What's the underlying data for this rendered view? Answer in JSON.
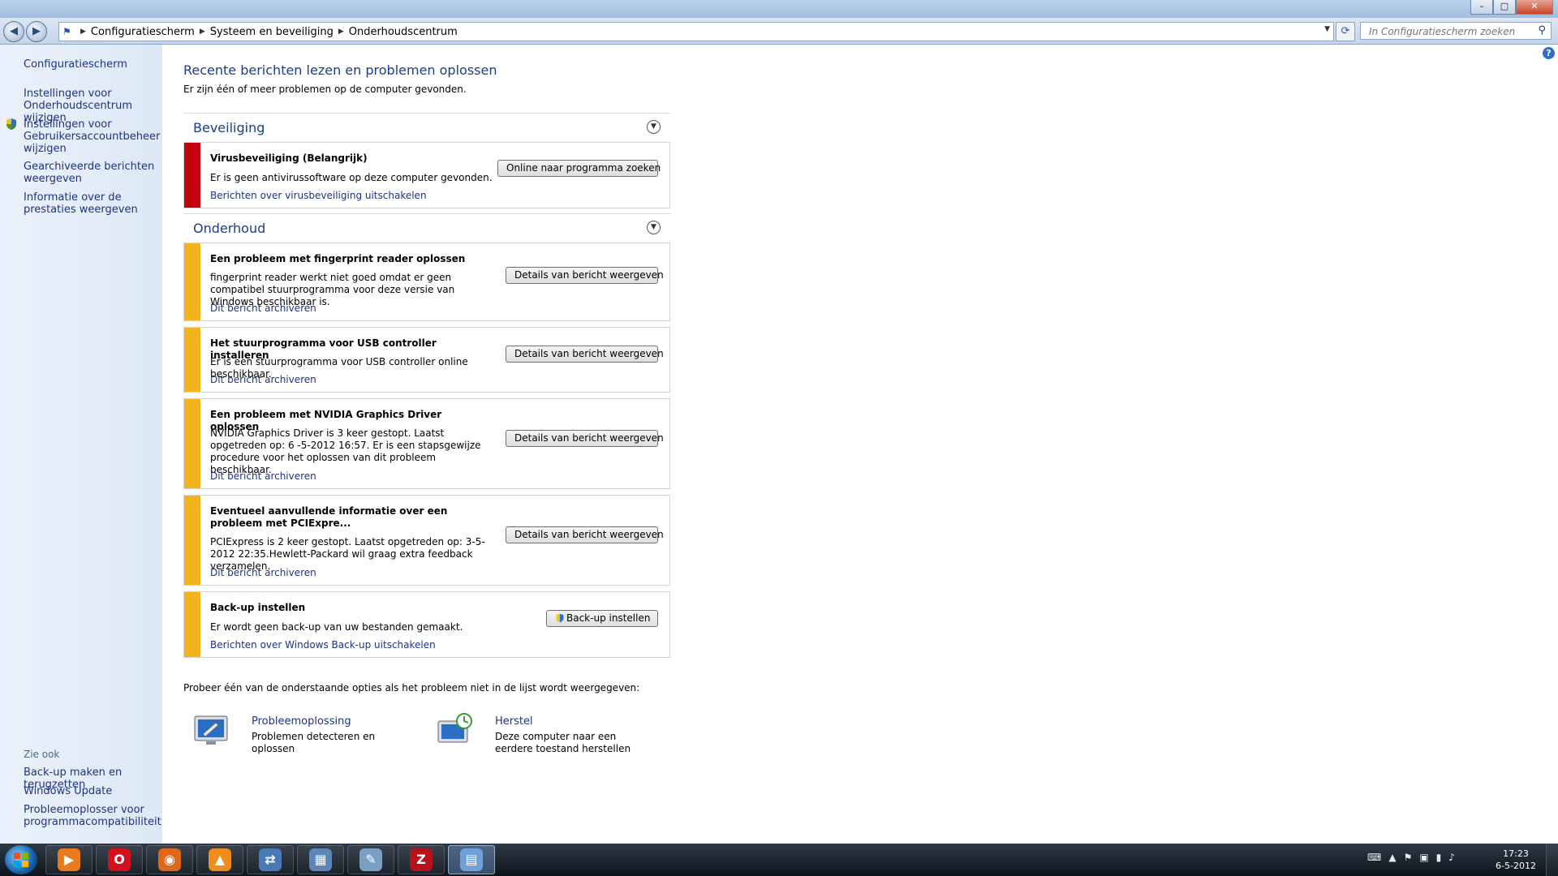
{
  "window": {
    "caption": {
      "minimize": "–",
      "maximize": "□",
      "close": "✕"
    }
  },
  "nav": {
    "back_icon": "◀",
    "forward_icon": "▶",
    "breadcrumbs": [
      "Configuratiescherm",
      "Systeem en beveiliging",
      "Onderhoudscentrum"
    ],
    "refresh_icon": "⟳",
    "search_placeholder": "In Configuratiescherm zoeken",
    "search_icon": "⚲"
  },
  "sidebar": {
    "home": "Configuratiescherm",
    "links": [
      "Instellingen voor Onderhoudscentrum wijzigen",
      "Instellingen voor Gebruikersaccountbeheer wijzigen",
      "Gearchiveerde berichten weergeven",
      "Informatie over de prestaties weergeven"
    ],
    "see_also_title": "Zie ook",
    "see_also": [
      "Back-up maken en terugzetten",
      "Windows Update",
      "Probleemoplosser voor programmacompatibiliteit"
    ]
  },
  "main": {
    "title": "Recente berichten lezen en problemen oplossen",
    "subtitle": "Er zijn één of meer problemen op de computer gevonden.",
    "sections": {
      "security": {
        "title": "Beveiliging",
        "items": [
          {
            "title": "Virusbeveiliging  (Belangrijk)",
            "desc": "Er is geen antivirussoftware op deze computer gevonden.",
            "link": "Berichten over virusbeveiliging uitschakelen",
            "button": "Online naar programma zoeken"
          }
        ]
      },
      "maintenance": {
        "title": "Onderhoud",
        "items": [
          {
            "title": "Een probleem met fingerprint reader oplossen",
            "desc": "fingerprint reader werkt niet goed omdat er geen compatibel stuurprogramma voor deze versie van Windows beschikbaar is.",
            "link": "Dit bericht archiveren",
            "button": "Details van bericht weergeven"
          },
          {
            "title": "Het stuurprogramma voor USB controller installeren",
            "desc": "Er is een stuurprogramma voor USB controller online beschikbaar.",
            "link": "Dit bericht archiveren",
            "button": "Details van bericht weergeven"
          },
          {
            "title": "Een probleem met NVIDIA Graphics Driver oplossen",
            "desc": "NVIDIA Graphics Driver is 3 keer gestopt. Laatst opgetreden op: 6 -5-2012 16:57. Er is een stapsgewijze procedure voor het oplossen van dit probleem beschikbaar.",
            "link": "Dit bericht archiveren",
            "button": "Details van bericht weergeven"
          },
          {
            "title": "Eventueel aanvullende informatie over een probleem met PCIExpre...",
            "desc": "PCIExpress is 2 keer gestopt. Laatst opgetreden op: 3-5-2012 22:35.Hewlett-Packard wil graag extra feedback verzamelen.",
            "link": "Dit bericht archiveren",
            "button": "Details van bericht weergeven"
          },
          {
            "title": "Back-up instellen",
            "desc": "Er wordt geen back-up van uw bestanden gemaakt.",
            "link": "Berichten over Windows Back-up uitschakelen",
            "button": "Back-up instellen"
          }
        ]
      }
    },
    "footer_note": "Probeer één van de onderstaande opties als het probleem niet in de lijst wordt weergegeven:",
    "options": [
      {
        "title": "Probleemoplossing",
        "desc": "Problemen detecteren en oplossen"
      },
      {
        "title": "Herstel",
        "desc": "Deze computer naar een eerdere toestand herstellen"
      }
    ]
  },
  "help_icon": "?",
  "taskbar": {
    "apps": [
      {
        "name": "media-player",
        "glyph": "▶",
        "color": "#e87b1c"
      },
      {
        "name": "opera",
        "glyph": "O",
        "color": "#d40f1e"
      },
      {
        "name": "firefox",
        "glyph": "◉",
        "color": "#e0661a"
      },
      {
        "name": "vlc",
        "glyph": "▲",
        "color": "#f08c1a"
      },
      {
        "name": "network-tool",
        "glyph": "⇄",
        "color": "#4a7ab5"
      },
      {
        "name": "print-tool",
        "glyph": "▦",
        "color": "#5b86b8"
      },
      {
        "name": "paint-tool",
        "glyph": "✎",
        "color": "#7a9fc4"
      },
      {
        "name": "filezilla",
        "glyph": "Z",
        "color": "#b5121b"
      },
      {
        "name": "control-panel",
        "glyph": "▤",
        "color": "#6fa0d8"
      }
    ],
    "tray_icons": [
      "⌨",
      "▲",
      "⚑",
      "▣",
      "▮",
      "♪"
    ],
    "time": "17:23",
    "date": "6-5-2012"
  }
}
